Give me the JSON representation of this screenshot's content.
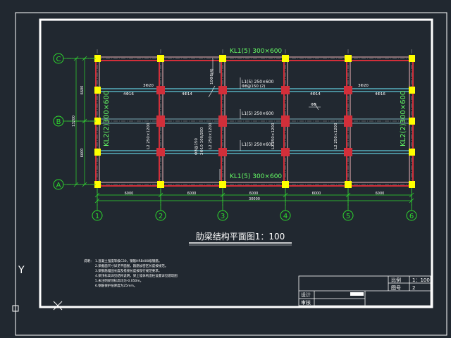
{
  "colors": {
    "background": "#212830",
    "frame": "#ffffff",
    "beam_red": "#d22f3a",
    "beam_pink": "#f2b3b8",
    "beam_cyan": "#5fc8d8",
    "column": "#ffff00",
    "grid_green": "#2edb2e",
    "annotation_green": "#66ff66",
    "text_white": "#ffffff"
  },
  "axes": {
    "vertical": [
      "1",
      "2",
      "3",
      "4",
      "5",
      "6"
    ],
    "horizontal": [
      "C",
      "B",
      "A"
    ]
  },
  "dimensions": {
    "spans": [
      "6000",
      "6000",
      "6000",
      "6000",
      "6000"
    ],
    "total": "30000",
    "left_segments": [
      "6600",
      "6600"
    ],
    "left_total": "13200"
  },
  "beam_labels": {
    "top": "KL1(5) 300×600",
    "bottom": "KL1(5) 300×600",
    "left": "KL2(2)300×600",
    "right": "KL2(2)300×600",
    "l1_a": "L1(5) 250×600",
    "l1_b": "L1(5) 250×600",
    "l1_c": "L1(5) 250×600",
    "l2_a": "L2 250×1200",
    "l2_b": "L2 250×1200",
    "l2_c": "L2 250×1200",
    "l2_d": "L2 250×1200"
  },
  "rebar_labels": {
    "r1": "3Φ20",
    "r2": "4Φ16",
    "r3": "4Φ14",
    "r4": "4Φ14",
    "r5": "3Φ20",
    "r6": "4Φ16",
    "stirrup": "Φ8@150 (2)",
    "mid_a": "2Φ10 100/200",
    "mid_b": "Φ8@150",
    "top_small": "10Φ8(4)",
    "mark": "Φ8"
  },
  "title": "肋梁结构平面图1：100",
  "notes": {
    "heading": "说明：",
    "items": [
      "1.混凝土强度等级C30，钢筋HRB400级钢筋。",
      "2.梁截面尺寸详见平面图，箍筋加密区长度按规范。",
      "3.梁钢筋锚固长度及搭接长度按现行规范要求。",
      "4.梁顶标高详见结构说明，梁上墙体构造柱设置详见建筑图",
      "5.未注明梁顶标高均为-0.050m。",
      "6.钢筋保护层厚度为25mm。"
    ]
  },
  "title_block": {
    "scale_label": "比例",
    "scale_value": "1：100",
    "drawing_label": "图号",
    "drawing_value": "2",
    "design_label": "设计",
    "review_label": "审核"
  },
  "ucs": {
    "y_label": "Y"
  }
}
